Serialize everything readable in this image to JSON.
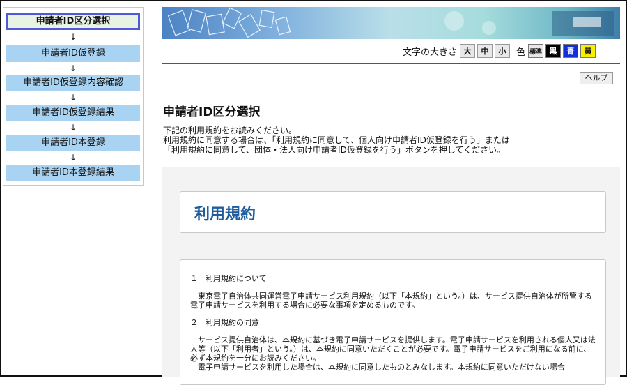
{
  "sidebar": {
    "steps": [
      "申請者ID区分選択",
      "申請者ID仮登録",
      "申請者ID仮登録内容確認",
      "申請者ID仮登録結果",
      "申請者ID本登録",
      "申請者ID本登録結果"
    ],
    "arrow": "↓"
  },
  "controls": {
    "font_size_label": "文字の大きさ",
    "sizes": [
      "大",
      "中",
      "小"
    ],
    "color_label": "色",
    "colors": [
      "標準",
      "黒",
      "青",
      "黄"
    ],
    "color_values": [
      "#e8e8e8",
      "#000000",
      "#1230d6",
      "#f7f000"
    ]
  },
  "help_label": "ヘルプ",
  "page_title": "申請者ID区分選択",
  "intro": [
    "下記の利用規約をお読みください。",
    "利用規約に同意する場合は、「利用規約に同意して、個人向け申請者ID仮登録を行う」または",
    "「利用規約に同意して、団体・法人向け申請者ID仮登録を行う」ボタンを押してください。"
  ],
  "terms": {
    "heading": "利用規約",
    "section1_title": "１　利用規約について",
    "section1_body": "東京電子自治体共同運営電子申請サービス利用規約（以下「本規約」という。）は、サービス提供自治体が所管する電子申請サービスを利用する場合に必要な事項を定めるものです。",
    "section2_title": "２　利用規約の同意",
    "section2_body1": "サービス提供自治体は、本規約に基づき電子申請サービスを提供します。電子申請サービスを利用される個人又は法人等（以下「利用者」という。）は、本規約に同意いただくことが必要です。電子申請サービスをご利用になる前に、必ず本規約を十分にお読みください。",
    "section2_body2": "電子申請サービスを利用した場合は、本規約に同意したものとみなします。本規約に同意いただけない場合"
  }
}
